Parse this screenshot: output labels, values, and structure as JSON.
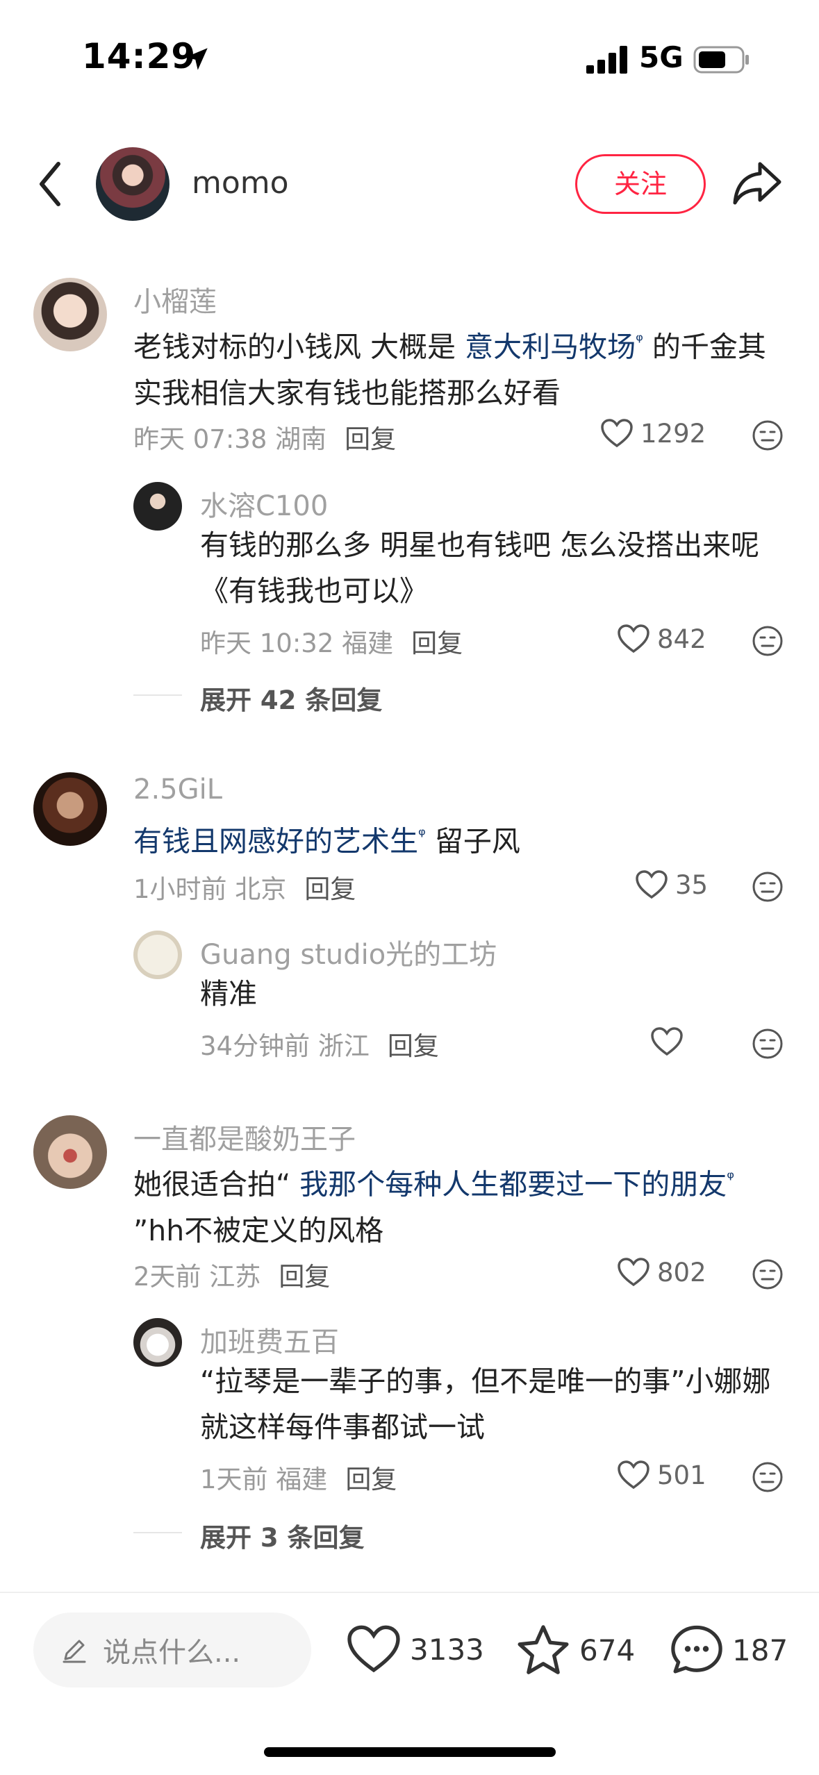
{
  "status_bar": {
    "time": "14:29",
    "network": "5G"
  },
  "header": {
    "username": "momo",
    "follow_label": "关注"
  },
  "comments": [
    {
      "user": "小榴莲",
      "text_pre": "老钱对标的小钱风 大概是 ",
      "link": "意大利马牧场",
      "text_post": " 的千金其实我相信大家有钱也能搭那么好看",
      "meta": "昨天 07:38 湖南",
      "reply_label": "回复",
      "likes": "1292",
      "reply": {
        "user": "水溶C100",
        "text": "有钱的那么多 明星也有钱吧 怎么没搭出来呢《有钱我也可以》",
        "meta": "昨天 10:32 福建",
        "reply_label": "回复",
        "likes": "842"
      },
      "expand": "展开 42 条回复"
    },
    {
      "user": "2.5GiL",
      "link": "有钱且网感好的艺术生",
      "text_post": " 留子风",
      "meta": "1小时前 北京",
      "reply_label": "回复",
      "likes": "35",
      "reply": {
        "user": "Guang studio光的工坊",
        "text": "精准",
        "meta": "34分钟前 浙江",
        "reply_label": "回复",
        "likes": ""
      }
    },
    {
      "user": "一直都是酸奶王子",
      "text_pre": "她很适合拍“ ",
      "link": "我那个每种人生都要过一下的朋友",
      "text_post": " ”hh不被定义的风格",
      "meta": "2天前 江苏",
      "reply_label": "回复",
      "likes": "802",
      "reply": {
        "user": "加班费五百",
        "text": "“拉琴是一辈子的事，但不是唯一的事”小娜娜就这样每件事都试一试",
        "meta": "1天前 福建",
        "reply_label": "回复",
        "likes": "501"
      },
      "expand": "展开 3 条回复"
    }
  ],
  "bottom_bar": {
    "input_placeholder": "说点什么...",
    "likes": "3133",
    "stars": "674",
    "comments": "187"
  }
}
